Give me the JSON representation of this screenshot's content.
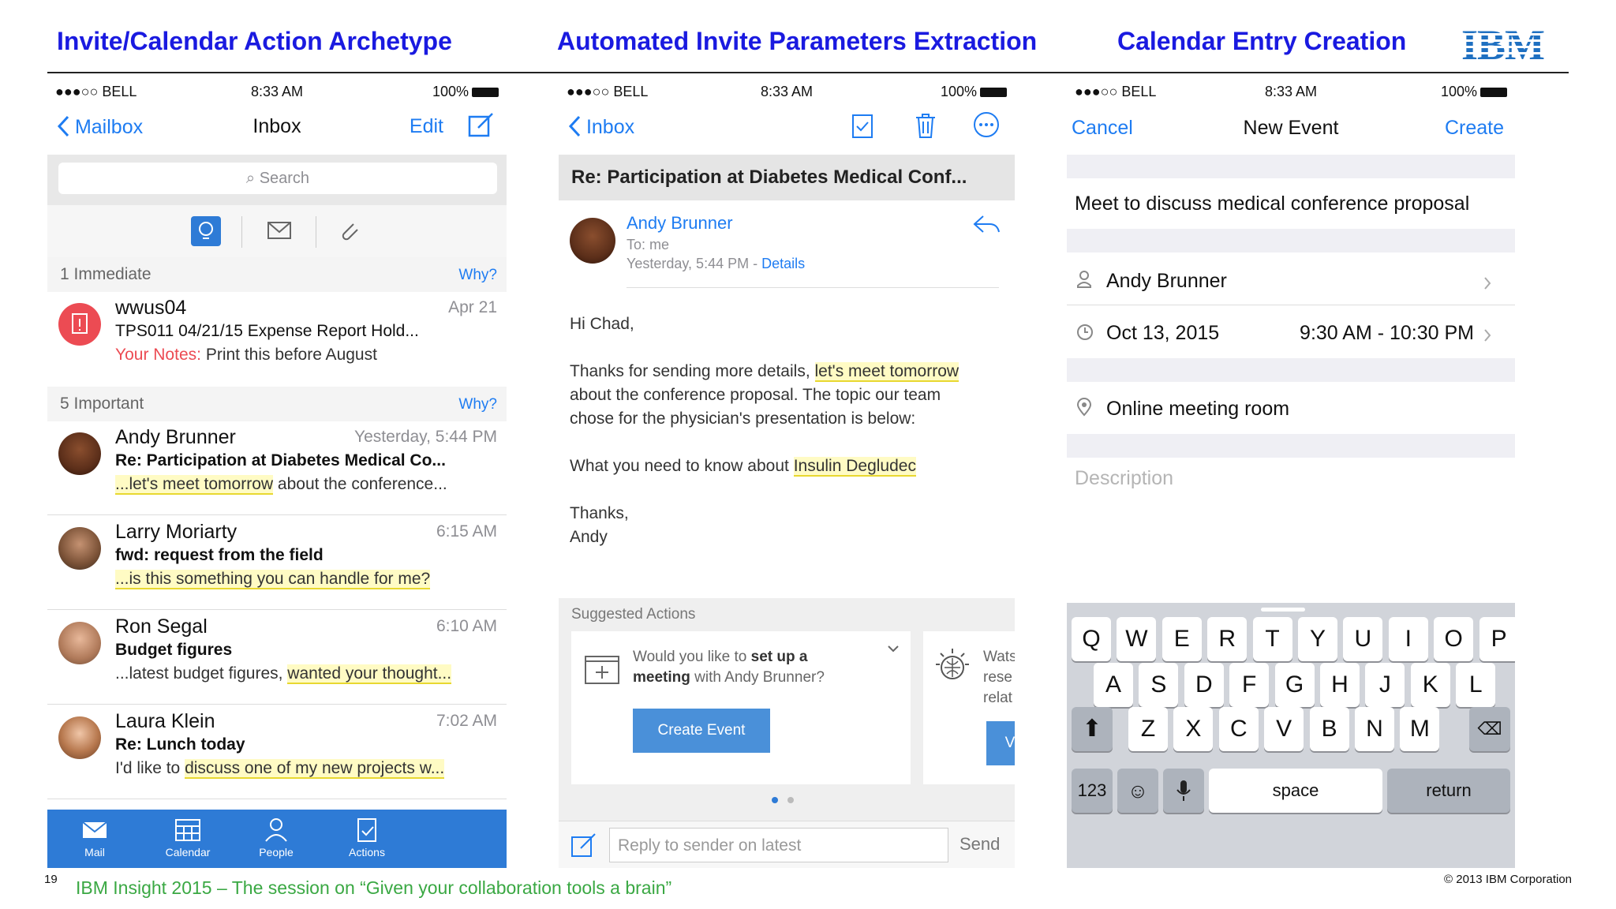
{
  "titles": {
    "left": "Invite/Calendar Action Archetype",
    "middle": "Automated Invite Parameters Extraction",
    "right": "Calendar Entry Creation"
  },
  "logo": {
    "text": "IBM",
    "color": "#1f70c1"
  },
  "status": {
    "carrier": "●●●○○ BELL",
    "time": "8:33 AM",
    "battery": "100%"
  },
  "phone1": {
    "nav": {
      "back": "Mailbox",
      "title": "Inbox",
      "edit": "Edit"
    },
    "search_placeholder": "Search",
    "section_immediate": {
      "label": "1 Immediate",
      "why": "Why?"
    },
    "section_important": {
      "label": "5 Important",
      "why": "Why?"
    },
    "immediate_mail": {
      "from": "wwus04",
      "date": "Apr 21",
      "subject": "TPS011 04/21/15 Expense Report Hold...",
      "notes_label": "Your Notes:",
      "notes_text": "Print this before August"
    },
    "mails": [
      {
        "from": "Andy Brunner",
        "date": "Yesterday, 5:44 PM",
        "subject": "Re: Participation at Diabetes Medical Co...",
        "prev_hl": "...let's meet tomorrow",
        "prev_rest": " about the conference..."
      },
      {
        "from": "Larry Moriarty",
        "date": "6:15 AM",
        "subject": "fwd: request from the field",
        "prev_hl": "...is this something you can handle for me?",
        "prev_rest": ""
      },
      {
        "from": "Ron Segal",
        "date": "6:10 AM",
        "subject": "Budget figures",
        "prev_plain": "...latest budget figures, ",
        "prev_hl": "wanted your thought...",
        "prev_rest": ""
      },
      {
        "from": "Laura Klein",
        "date": "7:02 AM",
        "subject": "Re: Lunch today",
        "prev_plain": "I'd like to ",
        "prev_hl": "discuss one of my new projects w...",
        "prev_rest": ""
      }
    ],
    "tabs": [
      "Mail",
      "Calendar",
      "People",
      "Actions"
    ]
  },
  "phone2": {
    "nav": {
      "back": "Inbox"
    },
    "subject": "Re: Participation at Diabetes Medical Conf...",
    "sender": "Andy Brunner",
    "to": "To: me",
    "when": "Yesterday, 5:44 PM - ",
    "details": "Details",
    "greeting": "Hi Chad,",
    "p1_a": "Thanks for sending more details, ",
    "p1_hl": "let's meet tomorrow",
    "p1_b": "about the conference proposal. The topic our team",
    "p1_c": "chose for the physician's presentation is below:",
    "p2_a": "What you need to know about ",
    "p2_hl": "Insulin Degludec",
    "thanks": "Thanks,",
    "sign": "Andy",
    "suggested_label": "Suggested Actions",
    "card_text_a": "Would you like to ",
    "card_text_bold1": "set up a",
    "card_text_bold2": "meeting",
    "card_text_b": " with Andy Brunner?",
    "create_button": "Create Event",
    "card2_lines": [
      "Wats",
      "rese",
      "relat"
    ],
    "card2_button": "V",
    "reply_placeholder": "Reply to sender on latest",
    "send": "Send"
  },
  "phone3": {
    "nav": {
      "cancel": "Cancel",
      "title": "New Event",
      "create": "Create"
    },
    "event_title": "Meet to discuss medical conference proposal",
    "invitee": "Andy Brunner",
    "date": "Oct 13, 2015",
    "time_range": "9:30 AM - 10:30 PM",
    "location": "Online meeting room",
    "description_placeholder": "Description",
    "keys_row1": [
      "Q",
      "W",
      "E",
      "R",
      "T",
      "Y",
      "U",
      "I",
      "O",
      "P"
    ],
    "keys_row2": [
      "A",
      "S",
      "D",
      "F",
      "G",
      "H",
      "J",
      "K",
      "L"
    ],
    "keys_row3": [
      "Z",
      "X",
      "C",
      "V",
      "B",
      "N",
      "M"
    ],
    "key_123": "123",
    "key_space": "space",
    "key_return": "return"
  },
  "footer": {
    "page": "19",
    "text": "IBM Insight 2015 – The session on “Given your collaboration tools a brain”",
    "copyright": "© 2013 IBM Corporation"
  }
}
